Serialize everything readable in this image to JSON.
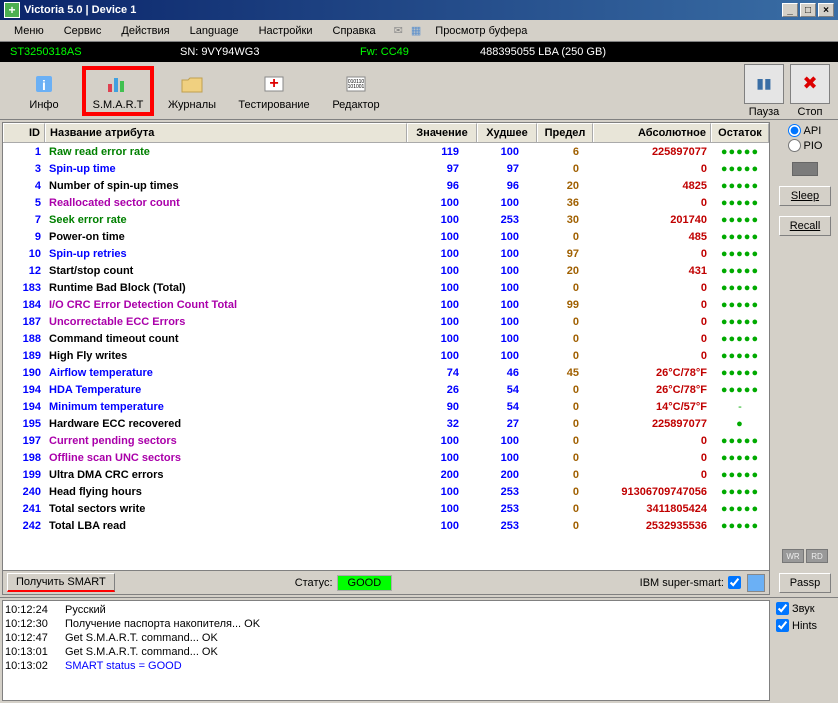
{
  "title": "Victoria 5.0 | Device 1",
  "menu": {
    "items": [
      "Меню",
      "Сервис",
      "Действия",
      "Language",
      "Настройки",
      "Справка"
    ],
    "buffer": "Просмотр буфера"
  },
  "device": {
    "model": "ST3250318AS",
    "sn": "SN: 9VY94WG3",
    "fw": "Fw: CC49",
    "lba": "488395055 LBA (250 GB)"
  },
  "toolbar": {
    "info": "Инфо",
    "smart": "S.M.A.R.T",
    "journals": "Журналы",
    "testing": "Тестирование",
    "editor": "Редактор",
    "pause": "Пауза",
    "stop": "Стоп"
  },
  "table": {
    "headers": {
      "id": "ID",
      "name": "Название атрибута",
      "val": "Значение",
      "worst": "Худшее",
      "thresh": "Предел",
      "raw": "Абсолютное",
      "health": "Остаток"
    },
    "rows": [
      {
        "id": "1",
        "name": "Raw read error rate",
        "color": "#008000",
        "val": "119",
        "worst": "100",
        "thresh": "6",
        "raw": "225897077",
        "health": "●●●●●",
        "hclass": "dots-g"
      },
      {
        "id": "3",
        "name": "Spin-up time",
        "color": "#0000ff",
        "val": "97",
        "worst": "97",
        "thresh": "0",
        "raw": "0",
        "health": "●●●●●",
        "hclass": "dots-y"
      },
      {
        "id": "4",
        "name": "Number of spin-up times",
        "color": "#000000",
        "val": "96",
        "worst": "96",
        "thresh": "20",
        "raw": "4825",
        "health": "●●●●●",
        "hclass": "dots-g"
      },
      {
        "id": "5",
        "name": "Reallocated sector count",
        "color": "#aa00aa",
        "val": "100",
        "worst": "100",
        "thresh": "36",
        "raw": "0",
        "health": "●●●●●",
        "hclass": "dots-g"
      },
      {
        "id": "7",
        "name": "Seek error rate",
        "color": "#008000",
        "val": "100",
        "worst": "253",
        "thresh": "30",
        "raw": "201740",
        "health": "●●●●●",
        "hclass": "dots-g"
      },
      {
        "id": "9",
        "name": "Power-on time",
        "color": "#000000",
        "val": "100",
        "worst": "100",
        "thresh": "0",
        "raw": "485",
        "health": "●●●●●",
        "hclass": "dots-g"
      },
      {
        "id": "10",
        "name": "Spin-up retries",
        "color": "#0000ff",
        "val": "100",
        "worst": "100",
        "thresh": "97",
        "raw": "0",
        "health": "●●●●●",
        "hclass": "dots-g"
      },
      {
        "id": "12",
        "name": "Start/stop count",
        "color": "#000000",
        "val": "100",
        "worst": "100",
        "thresh": "20",
        "raw": "431",
        "health": "●●●●●",
        "hclass": "dots-g"
      },
      {
        "id": "183",
        "name": "Runtime Bad Block (Total)",
        "color": "#000000",
        "val": "100",
        "worst": "100",
        "thresh": "0",
        "raw": "0",
        "health": "●●●●●",
        "hclass": "dots-g"
      },
      {
        "id": "184",
        "name": "I/O CRC Error Detection Count Total",
        "color": "#aa00aa",
        "val": "100",
        "worst": "100",
        "thresh": "99",
        "raw": "0",
        "health": "●●●●●",
        "hclass": "dots-g"
      },
      {
        "id": "187",
        "name": "Uncorrectable ECC Errors",
        "color": "#aa00aa",
        "val": "100",
        "worst": "100",
        "thresh": "0",
        "raw": "0",
        "health": "●●●●●",
        "hclass": "dots-g"
      },
      {
        "id": "188",
        "name": "Command timeout count",
        "color": "#000000",
        "val": "100",
        "worst": "100",
        "thresh": "0",
        "raw": "0",
        "health": "●●●●●",
        "hclass": "dots-g"
      },
      {
        "id": "189",
        "name": "High Fly writes",
        "color": "#000000",
        "val": "100",
        "worst": "100",
        "thresh": "0",
        "raw": "0",
        "health": "●●●●●",
        "hclass": "dots-g"
      },
      {
        "id": "190",
        "name": "Airflow temperature",
        "color": "#0000ff",
        "val": "74",
        "worst": "46",
        "thresh": "45",
        "raw": "26°C/78°F",
        "health": "●●●●●",
        "hclass": "dots-y"
      },
      {
        "id": "194",
        "name": "HDA Temperature",
        "color": "#0000ff",
        "val": "26",
        "worst": "54",
        "thresh": "0",
        "raw": "26°C/78°F",
        "health": "●●●●●",
        "hclass": "dots-g"
      },
      {
        "id": "194",
        "name": "Minimum temperature",
        "color": "#0000ff",
        "val": "90",
        "worst": "54",
        "thresh": "0",
        "raw": "14°C/57°F",
        "health": "-",
        "hclass": ""
      },
      {
        "id": "195",
        "name": "Hardware ECC recovered",
        "color": "#000000",
        "val": "32",
        "worst": "27",
        "thresh": "0",
        "raw": "225897077",
        "health": "●",
        "hclass": "dots-r"
      },
      {
        "id": "197",
        "name": "Current pending sectors",
        "color": "#aa00aa",
        "val": "100",
        "worst": "100",
        "thresh": "0",
        "raw": "0",
        "health": "●●●●●",
        "hclass": "dots-g"
      },
      {
        "id": "198",
        "name": "Offline scan UNC sectors",
        "color": "#aa00aa",
        "val": "100",
        "worst": "100",
        "thresh": "0",
        "raw": "0",
        "health": "●●●●●",
        "hclass": "dots-g"
      },
      {
        "id": "199",
        "name": "Ultra DMA CRC errors",
        "color": "#000000",
        "val": "200",
        "worst": "200",
        "thresh": "0",
        "raw": "0",
        "health": "●●●●●",
        "hclass": "dots-g"
      },
      {
        "id": "240",
        "name": "Head flying hours",
        "color": "#000000",
        "val": "100",
        "worst": "253",
        "thresh": "0",
        "raw": "91306709747056",
        "health": "●●●●●",
        "hclass": "dots-g"
      },
      {
        "id": "241",
        "name": "Total sectors write",
        "color": "#000000",
        "val": "100",
        "worst": "253",
        "thresh": "0",
        "raw": "3411805424",
        "health": "●●●●●",
        "hclass": "dots-g"
      },
      {
        "id": "242",
        "name": "Total LBA read",
        "color": "#000000",
        "val": "100",
        "worst": "253",
        "thresh": "0",
        "raw": "2532935536",
        "health": "●●●●●",
        "hclass": "dots-g"
      }
    ]
  },
  "status": {
    "get_smart": "Получить SMART",
    "label": "Статус:",
    "value": "GOOD",
    "super": "IBM super-smart:"
  },
  "side": {
    "api": "API",
    "pio": "PIO",
    "sleep": "Sleep",
    "recall": "Recall",
    "passp": "Passp",
    "wr": "WR",
    "rd": "RD"
  },
  "log": {
    "rows": [
      {
        "time": "10:12:24",
        "text": "Русский",
        "color": "#000"
      },
      {
        "time": "10:12:30",
        "text": "Получение паспорта накопителя... OK",
        "color": "#000"
      },
      {
        "time": "10:12:47",
        "text": "Get S.M.A.R.T. command... OK",
        "color": "#000"
      },
      {
        "time": "10:13:01",
        "text": "Get S.M.A.R.T. command... OK",
        "color": "#000"
      },
      {
        "time": "10:13:02",
        "text": "SMART status = GOOD",
        "color": "#0000ff"
      }
    ],
    "side": {
      "sound": "Звук",
      "hints": "Hints"
    }
  }
}
